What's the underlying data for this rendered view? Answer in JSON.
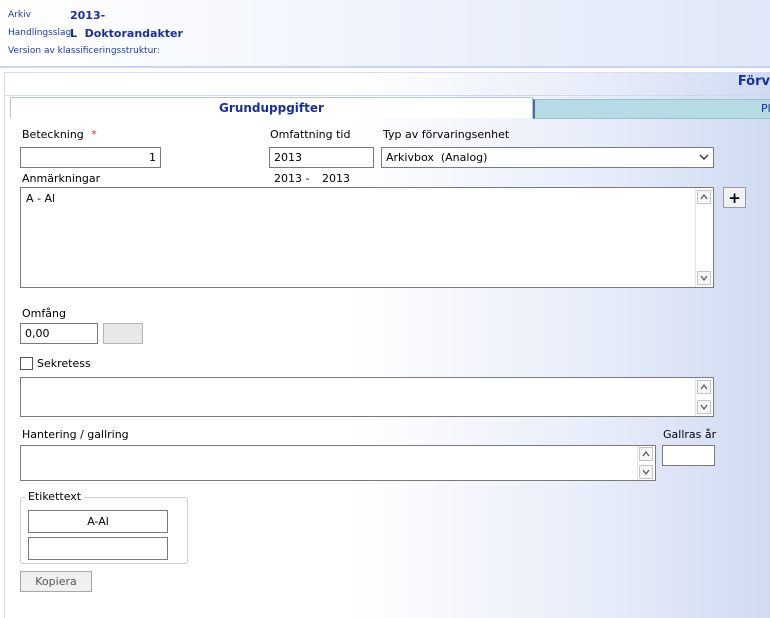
{
  "header": {
    "arkiv_label": "Arkiv",
    "arkiv_value": "2013-",
    "handlingsslag_label": "Handlingsslag",
    "handlingsslag_value": "L  Doktorandakter",
    "version_label": "Version av klassificeringsstruktur:"
  },
  "panel_title": "Förv",
  "tabs": [
    {
      "label": "Grunduppgifter",
      "active": true
    },
    {
      "label": "Pla",
      "active": false
    }
  ],
  "form": {
    "beteckning_label": "Beteckning",
    "required_mark": "*",
    "beteckning_value": "1",
    "omfattning_label": "Omfattning tid",
    "omfattning_value": "2013",
    "typ_label": "Typ av förvaringsenhet",
    "typ_value": "Arkivbox  (Analog)",
    "anmarkningar_label": "Anmärkningar",
    "tid_from": "2013 -",
    "tid_to": "2013",
    "anmarkningar_value": "A - Al",
    "plus_label": "+",
    "omfang_label": "Omfång",
    "omfang_value": "0,00",
    "sekretess_label": "Sekretess",
    "hantering_label": "Hantering / gallring",
    "gallras_label": "Gallras år",
    "etikettext_label": "Etikettext",
    "etikett_line1": "A-Al",
    "etikett_line2": "",
    "kopiera_label": "Kopiera"
  },
  "colors": {
    "accent_text": "#1a2f9c",
    "tab_inactive_bg": "#b5dbe4",
    "required": "#d03030"
  }
}
